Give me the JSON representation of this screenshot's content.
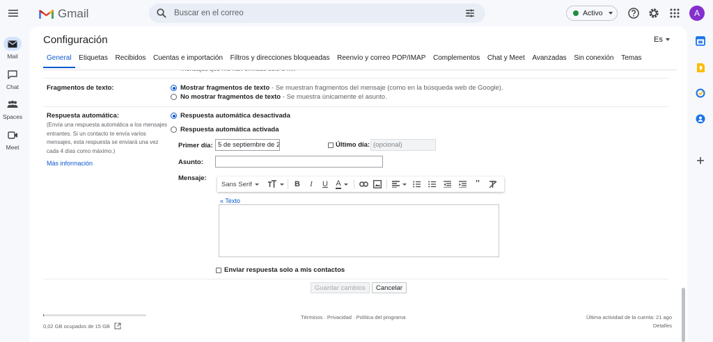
{
  "header": {
    "app_name": "Gmail",
    "search_placeholder": "Buscar en el correo",
    "status_label": "Activo",
    "status_color": "#1e8e3e",
    "avatar_letter": "A",
    "avatar_color": "#8430ce",
    "icons": [
      "menu-icon",
      "search-icon",
      "filter-options-icon",
      "help-icon",
      "settings-icon",
      "apps-grid-icon"
    ]
  },
  "rail": {
    "items": [
      {
        "label": "Mail",
        "icon": "mail-icon",
        "active": true
      },
      {
        "label": "Chat",
        "icon": "chat-icon",
        "active": false
      },
      {
        "label": "Spaces",
        "icon": "spaces-icon",
        "active": false
      },
      {
        "label": "Meet",
        "icon": "meet-icon",
        "active": false
      }
    ]
  },
  "right_rail": {
    "icons": [
      "calendar-icon",
      "keep-icon",
      "tasks-icon",
      "contacts-icon",
      "add-icon"
    ]
  },
  "page": {
    "title": "Configuración",
    "language": "Es",
    "tabs": [
      {
        "label": "General",
        "active": true
      },
      {
        "label": "Etiquetas"
      },
      {
        "label": "Recibidos"
      },
      {
        "label": "Cuentas e importación"
      },
      {
        "label": "Filtros y direcciones bloqueadas"
      },
      {
        "label": "Reenvío y correo POP/IMAP"
      },
      {
        "label": "Complementos"
      },
      {
        "label": "Chat y Meet"
      },
      {
        "label": "Avanzadas"
      },
      {
        "label": "Sin conexión"
      },
      {
        "label": "Temas"
      }
    ],
    "cut_text": "mensajes que me han enviado solo a mí."
  },
  "snippets": {
    "label": "Fragmentos de texto:",
    "show_bold": "Mostrar fragmentos de texto",
    "show_desc": " - Se muestran fragmentos del mensaje (como en la búsqueda web de Google).",
    "hide_bold": "No mostrar fragmentos de texto",
    "hide_desc": " - Se muestra únicamente el asunto.",
    "selected": "show"
  },
  "autoreply": {
    "label": "Respuesta automática:",
    "help_lines": [
      "(Envía una respuesta automática a los mensajes",
      "entrantes. Si un contacto te envía varios",
      "mensajes, esta respuesta se enviará una vez",
      "cada 4 días como máximo.)"
    ],
    "more_info": "Más información",
    "off_label": "Respuesta automática desactivada",
    "on_label": "Respuesta automática activada",
    "selected": "off",
    "first_day_label": "Primer día:",
    "first_day_value": "5 de septiembre de 2",
    "last_day_label": "Último día:",
    "last_day_placeholder": "(opcional)",
    "subject_label": "Asunto:",
    "subject_value": "",
    "message_label": "Mensaje:",
    "font_name": "Sans Serif",
    "plain_text_link": "« Texto",
    "contacts_only_label": "Enviar respuesta solo a mis contactos"
  },
  "actions": {
    "save_label": "Guardar cambios",
    "cancel_label": "Cancelar"
  },
  "footer": {
    "storage": "0,02 GB ocupados de 15 GB",
    "storage_fraction": 0.0013,
    "links": "Términos · Privacidad · Política del programa",
    "last_activity": "Última actividad de la cuenta: 21 ago",
    "details": "Detalles"
  }
}
